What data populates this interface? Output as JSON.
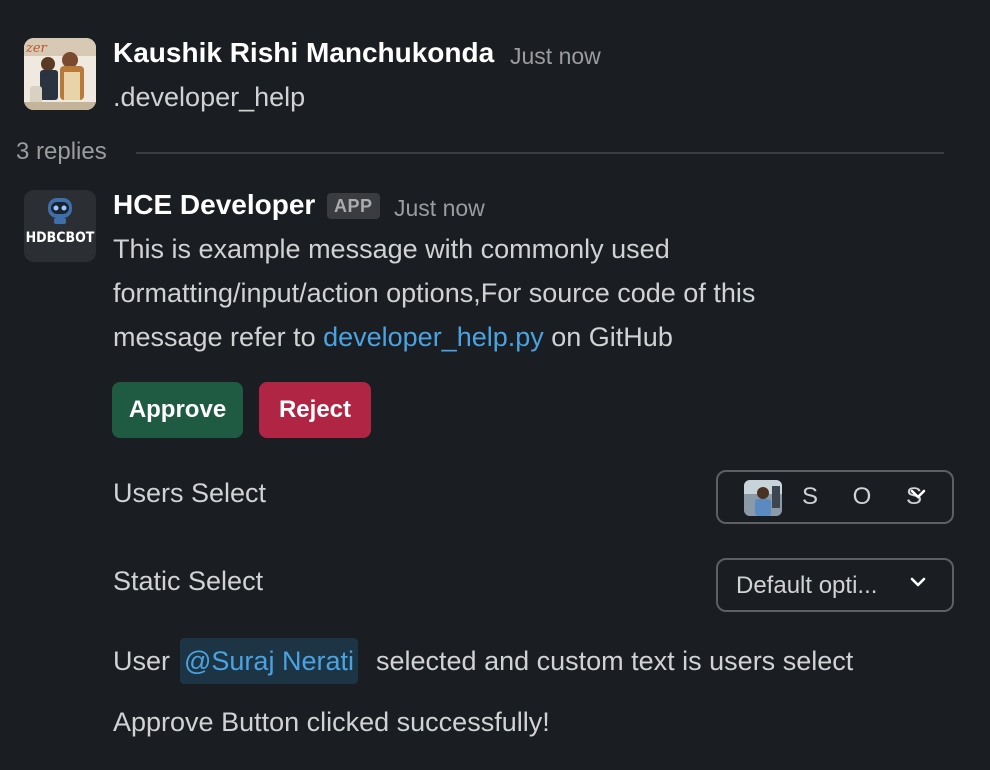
{
  "message1": {
    "author": "Kaushik Rishi Manchukonda",
    "time": "Just now",
    "text": ".developer_help"
  },
  "thread": {
    "replies_label": "3 replies"
  },
  "message2": {
    "author": "HCE Developer",
    "badge": "APP",
    "time": "Just now",
    "bot_avatar_text": "HDBCBOT",
    "line1": "This is example message with commonly used",
    "line2": "formatting/input/action options,For source code of this",
    "line3_prefix": "message refer to ",
    "link_text": "developer_help.py",
    "line3_suffix": " on GitHub",
    "buttons": {
      "approve": "Approve",
      "reject": "Reject"
    },
    "users_select": {
      "label": "Users Select",
      "value": "S O S"
    },
    "static_select": {
      "label": "Static Select",
      "value": "Default opti..."
    },
    "selection_text": {
      "prefix": "User ",
      "mention": "@Suraj Nerati",
      "suffix": " selected and custom text is users select"
    },
    "status": "Approve Button clicked successfully!"
  },
  "colors": {
    "background": "#1a1d21",
    "approve": "#1f5a43",
    "reject": "#b02544",
    "link": "#4aa3e0"
  }
}
